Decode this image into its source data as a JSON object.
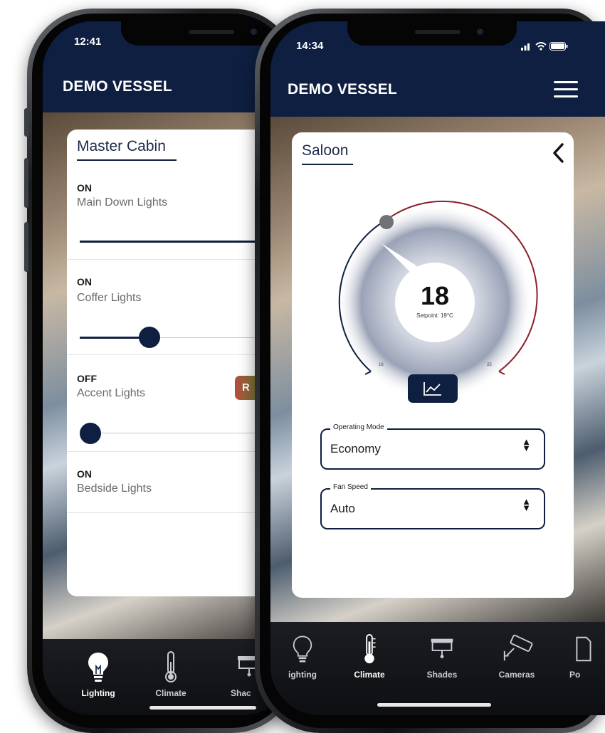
{
  "left_phone": {
    "status_time": "12:41",
    "app_title": "DEMO VESSEL",
    "card_title": "Master Cabin",
    "lights": [
      {
        "state": "ON",
        "name": "Main Down Lights",
        "level": 1.0
      },
      {
        "state": "ON",
        "name": "Coffer Lights",
        "level": 0.38
      },
      {
        "state": "OFF",
        "name": "Accent Lights",
        "level": 0.0,
        "badge": "R"
      },
      {
        "state": "ON",
        "name": "Bedside Lights"
      }
    ],
    "tabs": [
      {
        "label": "Lighting",
        "icon": "lightbulb-icon",
        "active": true
      },
      {
        "label": "Climate",
        "icon": "thermometer-icon",
        "active": false
      },
      {
        "label": "Shac",
        "icon": "shades-icon",
        "active": false
      }
    ]
  },
  "right_phone": {
    "status_time": "14:34",
    "app_title": "DEMO VESSEL",
    "card_title": "Saloon",
    "thermostat": {
      "value": "18",
      "setpoint": "Setpoint: 19°C",
      "min_label": "16",
      "max_label": "25"
    },
    "operating_mode": {
      "legend": "Operating Mode",
      "value": "Economy"
    },
    "fan_speed": {
      "legend": "Fan Speed",
      "value": "Auto"
    },
    "tabs": [
      {
        "label": "ighting",
        "icon": "lightbulb-icon",
        "active": false
      },
      {
        "label": "Climate",
        "icon": "thermometer-icon",
        "active": true
      },
      {
        "label": "Shades",
        "icon": "shades-icon",
        "active": false
      },
      {
        "label": "Cameras",
        "icon": "camera-icon",
        "active": false
      },
      {
        "label": "Po",
        "icon": "power-icon",
        "active": false
      }
    ]
  },
  "colors": {
    "navy": "#0e1f41",
    "arc_red": "#8a1f2b",
    "badge_red": "#b64a3c",
    "badge_green": "#6a8a3a"
  }
}
